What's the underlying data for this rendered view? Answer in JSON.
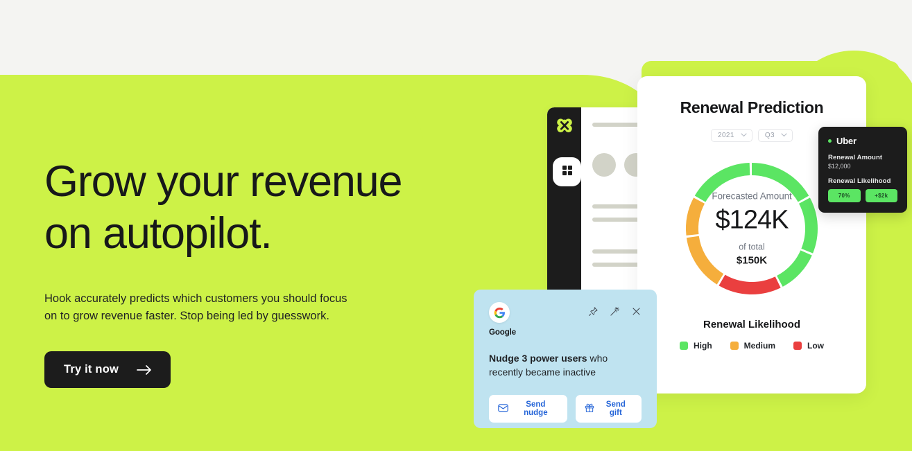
{
  "theme": {
    "page_bg": "#f4f4f2",
    "brand_green": "#cdf247",
    "dark": "#1c1c1c",
    "donut_high": "#5be563",
    "donut_medium": "#f5ae3c",
    "donut_low": "#ea3f3f",
    "nudge_bg": "#bfe3f0",
    "link_blue": "#2565d8"
  },
  "hero": {
    "heading_line1": "Grow your revenue",
    "heading_line2": "on autopilot.",
    "paragraph": "Hook accurately predicts which customers you should focus on to grow revenue faster. Stop being led by guesswork.",
    "cta_label": "Try it now",
    "cta_icon": "arrow-right-icon"
  },
  "app_window": {
    "logo_icon": "hook-clover-logo-icon",
    "active_tab_icon": "dashboard-grid-icon",
    "skeleton_placeholder": true
  },
  "prediction_card": {
    "title": "Renewal Prediction",
    "selects": [
      {
        "name": "year",
        "value": "2021",
        "caret_icon": "chevron-down-icon"
      },
      {
        "name": "quarter",
        "value": "Q3",
        "caret_icon": "chevron-down-icon"
      }
    ],
    "center": {
      "label": "Forecasted Amount",
      "amount": "$124K",
      "of_total_label": "of total",
      "total": "$150K"
    },
    "legend_title": "Renewal Likelihood",
    "legend": [
      {
        "label": "High",
        "color": "#5be563"
      },
      {
        "label": "Medium",
        "color": "#f5ae3c"
      },
      {
        "label": "Low",
        "color": "#ea3f3f"
      }
    ]
  },
  "chart_data": {
    "type": "pie",
    "title": "Renewal Prediction",
    "subtitle": "Forecasted Amount $124K of total $150K",
    "categories": [
      "High",
      "Medium",
      "Low"
    ],
    "values": [
      58,
      27,
      15
    ],
    "unit": "percent of total",
    "colors": [
      "#5be563",
      "#f5ae3c",
      "#ea3f3f"
    ],
    "legend_position": "bottom",
    "donut": true,
    "segments": [
      {
        "category": "High",
        "start_deg": 0,
        "end_deg": 60,
        "color": "#5be563"
      },
      {
        "category": "High",
        "start_deg": 62,
        "end_deg": 112,
        "color": "#5be563"
      },
      {
        "category": "High",
        "start_deg": 114,
        "end_deg": 152,
        "color": "#5be563"
      },
      {
        "category": "Low",
        "start_deg": 154,
        "end_deg": 210,
        "color": "#ea3f3f"
      },
      {
        "category": "Medium",
        "start_deg": 212,
        "end_deg": 262,
        "color": "#f5ae3c"
      },
      {
        "category": "Medium",
        "start_deg": 264,
        "end_deg": 298,
        "color": "#f5ae3c"
      },
      {
        "category": "High",
        "start_deg": 300,
        "end_deg": 358,
        "color": "#5be563"
      }
    ],
    "annotations": [
      "Forecasted Amount",
      "$124K",
      "of total",
      "$150K"
    ],
    "xlabel": "",
    "ylabel": ""
  },
  "tooltip": {
    "account": "Uber",
    "status_dot_color": "#5be563",
    "amount_label": "Renewal Amount",
    "amount_value": "$12,000",
    "likelihood_label": "Renewal Likelihood",
    "pill_percent": "70%",
    "pill_delta": "+$2k"
  },
  "nudge_card": {
    "brand": "Google",
    "brand_icon": "google-logo-icon",
    "actions_icons": [
      "pin-icon",
      "magic-wand-icon",
      "close-icon"
    ],
    "message_bold": "Nudge 3 power users",
    "message_rest": " who recently became inactive",
    "buttons": [
      {
        "label": "Send nudge",
        "icon": "envelope-icon"
      },
      {
        "label": "Send gift",
        "icon": "gift-icon"
      }
    ]
  }
}
